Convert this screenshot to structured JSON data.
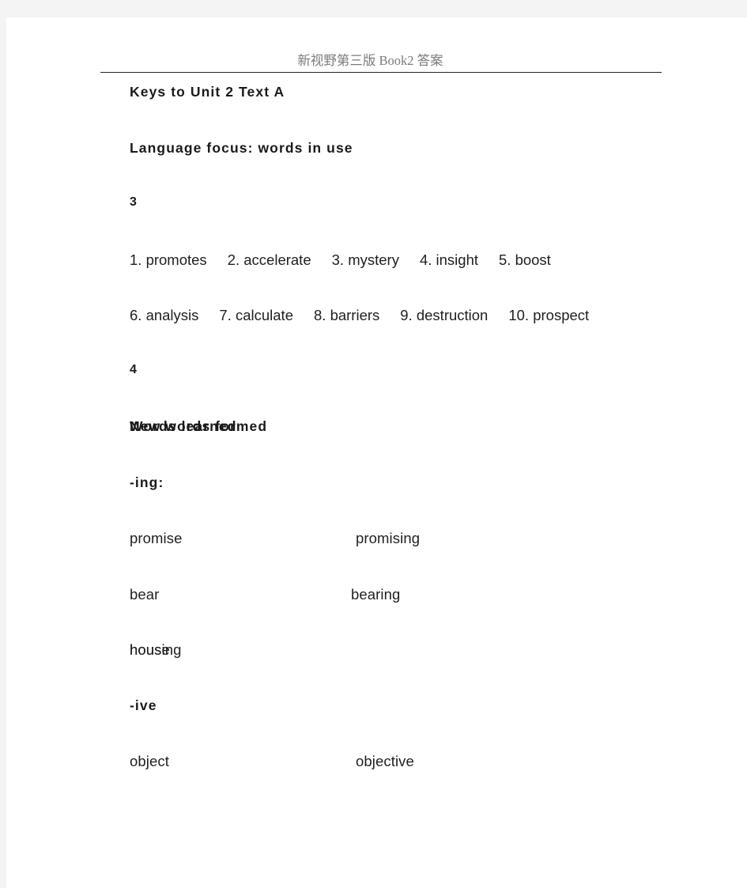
{
  "page": {
    "background_color": "#f4f4f4",
    "paper_color": "#ffffff",
    "rule_color": "#262626"
  },
  "header": {
    "title": "新视野第三版 Book2 答案",
    "color": "#7b7b7b"
  },
  "document": {
    "title": "Keys to Unit 2 Text A",
    "section_heading": "Language focus: words in use",
    "exercise_3": {
      "number": "3",
      "answers": [
        "1. promotes",
        "2. accelerate",
        "3. mystery",
        "4. insight",
        "5. boost"
      ],
      "answers_second_row": [
        "6. analysis",
        "7. calculate",
        "8. barriers",
        "9. destruction",
        "10. prospect"
      ]
    },
    "exercise_4": {
      "number": "4",
      "col_header_left": "Words learned",
      "col_header_right": "New words formed",
      "groups": [
        {
          "suffix": "-ing:",
          "rows": [
            {
              "learned": "promise",
              "formed": "promising"
            },
            {
              "learned": "bear",
              "formed": "bearing"
            },
            {
              "learned": "house",
              "formed": "housing"
            }
          ]
        },
        {
          "suffix": "-ive",
          "rows": [
            {
              "learned": "object",
              "formed": "objective"
            }
          ]
        }
      ]
    }
  }
}
